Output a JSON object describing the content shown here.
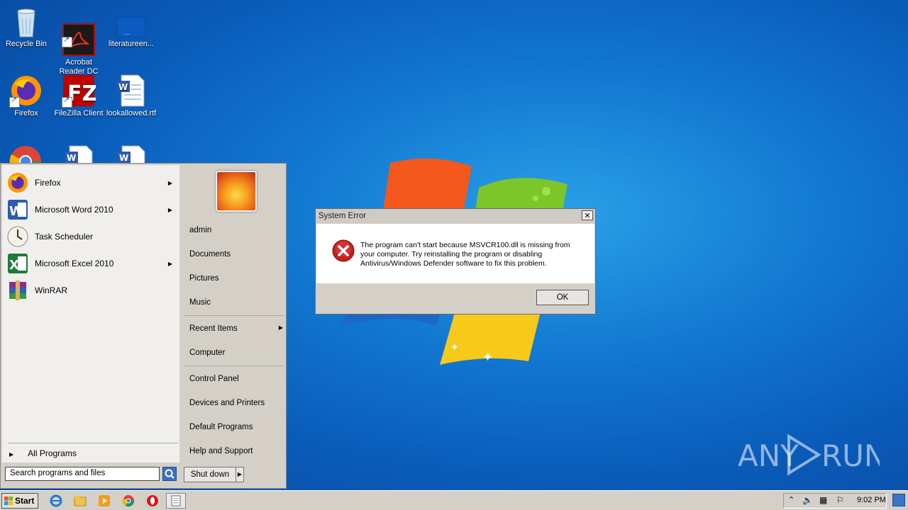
{
  "desktop": {
    "icons": [
      {
        "label": "Recycle Bin"
      },
      {
        "label": "Acrobat\nReader DC"
      },
      {
        "label": "literatureen..."
      },
      {
        "label": "Firefox"
      },
      {
        "label": "FileZilla Client"
      },
      {
        "label": "lookallowed.rtf"
      }
    ]
  },
  "start_menu": {
    "programs": [
      {
        "label": "Firefox",
        "has_submenu": true
      },
      {
        "label": "Microsoft Word 2010",
        "has_submenu": true
      },
      {
        "label": "Task Scheduler",
        "has_submenu": false
      },
      {
        "label": "Microsoft Excel 2010",
        "has_submenu": true
      },
      {
        "label": "WinRAR",
        "has_submenu": false
      }
    ],
    "all_programs": "All Programs",
    "search_placeholder": "Search programs and files",
    "places": {
      "user": "admin",
      "documents": "Documents",
      "pictures": "Pictures",
      "music": "Music",
      "recent_items": "Recent Items",
      "computer": "Computer",
      "control_panel": "Control Panel",
      "devices_printers": "Devices and Printers",
      "default_programs": "Default Programs",
      "help_support": "Help and Support"
    },
    "shutdown": "Shut down"
  },
  "dialog": {
    "title": "System Error",
    "message": "The program can't start because MSVCR100.dll is missing from your computer. Try reinstalling the program or disabling Antivirus/Windows Defender software to fix this problem.",
    "ok": "OK"
  },
  "taskbar": {
    "start": "Start",
    "clock": "9:02 PM"
  },
  "watermark": {
    "text_left": "ANY",
    "text_right": "RUN"
  }
}
